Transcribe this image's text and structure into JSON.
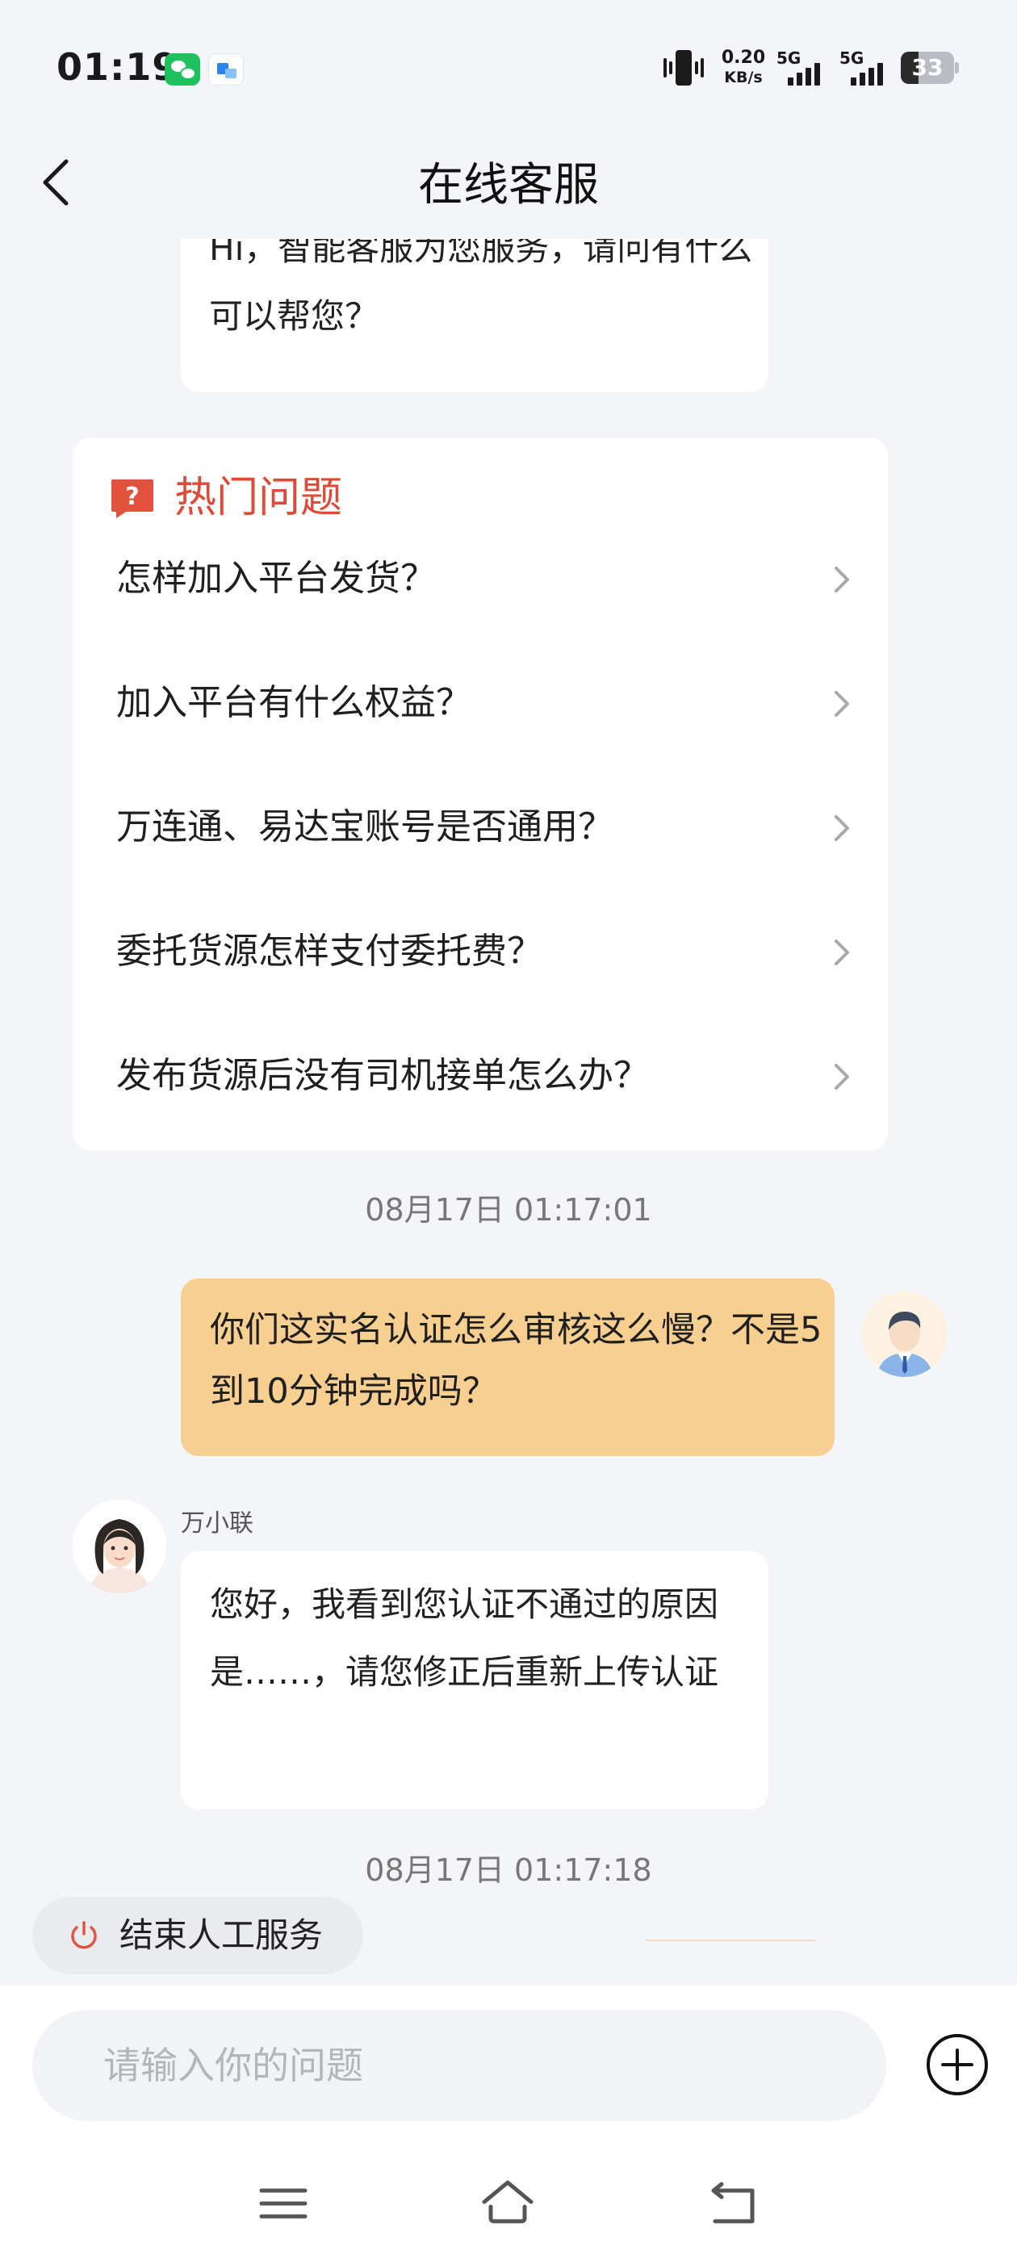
{
  "status_bar": {
    "time": "01:19",
    "net_speed_value": "0.20",
    "net_speed_unit": "KB/s",
    "signal1_label": "5G",
    "signal2_label": "5G",
    "battery_level": "33",
    "battery_fraction": 0.33
  },
  "header": {
    "title": "在线客服"
  },
  "chat": {
    "greeting": "Hi，智能客服为您服务，请问有什么可以帮您？",
    "hot_questions": {
      "title": "热门问题",
      "items": [
        "怎样加入平台发货？",
        "加入平台有什么权益？",
        "万连通、易达宝账号是否通用？",
        "委托货源怎样支付委托费？",
        "发布货源后没有司机接单怎么办？"
      ]
    },
    "timestamp_1": "08月17日 01:17:01",
    "user_message": "你们这实名认证怎么审核这么慢？不是5到10分钟完成吗？",
    "agent_name": "万小联",
    "agent_message": "您好，我看到您认证不通过的原因是……，请您修正后重新上传认证",
    "timestamp_2": "08月17日 01:17:18",
    "end_service_label": "结束人工服务"
  },
  "input": {
    "placeholder": "请输入你的问题",
    "value": ""
  },
  "colors": {
    "accent_red": "#de4a36",
    "user_bubble": "#f7cf90",
    "background": "#f4f5f8"
  }
}
